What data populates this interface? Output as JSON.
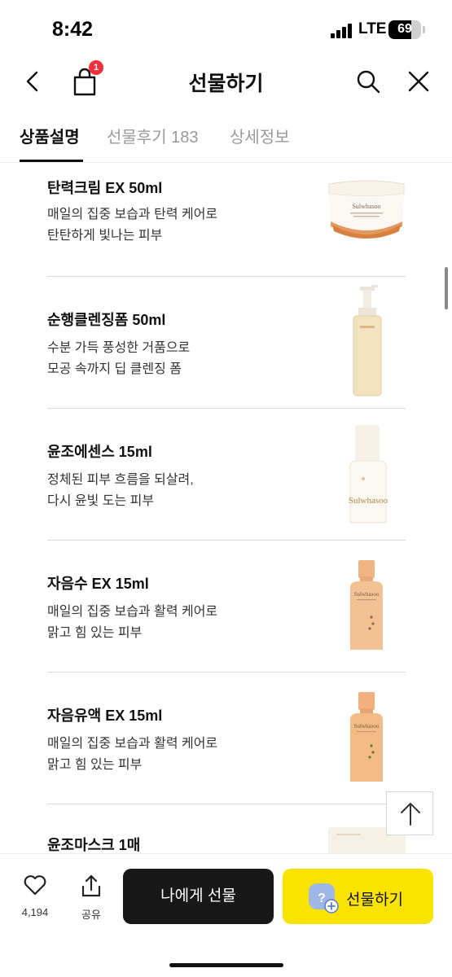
{
  "status_bar": {
    "time": "8:42",
    "network": "LTE",
    "battery": "69",
    "battery_level": 0.69
  },
  "header": {
    "title": "선물하기",
    "cart_badge": "1",
    "icons": {
      "back": "chevron-left-icon",
      "bag": "shopping-bag-icon",
      "search": "search-icon",
      "close": "close-icon"
    }
  },
  "tabs": [
    {
      "label": "상품설명",
      "active": true
    },
    {
      "label": "선물후기 183",
      "active": false
    },
    {
      "label": "상세정보",
      "active": false
    }
  ],
  "products": [
    {
      "name": "탄력크림 EX 50ml",
      "desc1": "매일의 집중 보습과 탄력 케어로",
      "desc2": "탄탄하게 빛나는 피부",
      "brand": "Sulwhasoo",
      "image": "cream-jar"
    },
    {
      "name": "순행클렌징폼 50ml",
      "desc1": "수분 가득 풍성한 거품으로",
      "desc2": "모공 속까지 딥 클렌징 폼",
      "brand": "Sulwhasoo",
      "image": "pump-bottle"
    },
    {
      "name": "윤조에센스 15ml",
      "desc1": "정체된 피부 흐름을 되살려,",
      "desc2": "다시 윤빛 도는 피부",
      "brand": "Sulwhasoo",
      "image": "essence-bottle"
    },
    {
      "name": "자음수 EX 15ml",
      "desc1": "매일의 집중 보습과 활력 케어로",
      "desc2": "맑고 힘 있는 피부",
      "brand": "Sulwhasoo",
      "image": "toner-bottle"
    },
    {
      "name": "자음유액 EX 15ml",
      "desc1": "매일의 집중 보습과 활력 케어로",
      "desc2": "맑고 힘 있는 피부",
      "brand": "Sulwhasoo",
      "image": "emulsion-bottle"
    },
    {
      "name": "윤조마스크 1매",
      "desc1": "",
      "desc2": "",
      "brand": "",
      "image": "mask-pack"
    }
  ],
  "bottom_bar": {
    "like_count": "4,194",
    "share_label": "공유",
    "gift_me_label": "나에게 선물",
    "gift_label": "선물하기",
    "icons": {
      "like": "heart-icon",
      "share": "share-icon",
      "gift": "gift-friend-icon",
      "scroll_top": "arrow-up-icon"
    }
  },
  "colors": {
    "accent_yellow": "#fbe300",
    "dark_button": "#181818",
    "badge_red": "#f0303a",
    "bottle_orange": "#eeb07a"
  }
}
